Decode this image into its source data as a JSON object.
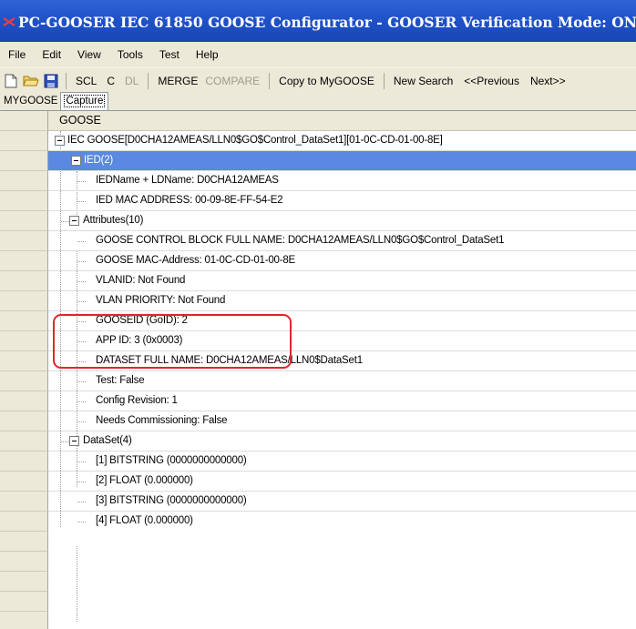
{
  "window": {
    "title": "PC-GOOSER   IEC 61850 GOOSE Configurator - GOOSER Verification Mode: ON"
  },
  "menu": [
    "File",
    "Edit",
    "View",
    "Tools",
    "Test",
    "Help"
  ],
  "toolbar": {
    "scl": "SCL",
    "c": "C",
    "dl": "DL",
    "merge": "MERGE",
    "compare": "COMPARE",
    "copy_to_mygoose": "Copy to MyGOOSE",
    "new_search": "New Search",
    "previous": "<<Previous",
    "next": "Next>>"
  },
  "tabs": [
    "MYGOOSE",
    "Capture"
  ],
  "tree": {
    "header": "GOOSE",
    "root": "IEC GOOSE[D0CHA12AMEAS/LLN0$GO$Control_DataSet1][01-0C-CD-01-00-8E]",
    "ied": {
      "label": "IED(2)",
      "items": [
        "IEDName + LDName: D0CHA12AMEAS",
        "IED MAC ADDRESS: 00-09-8E-FF-54-E2"
      ]
    },
    "attributes": {
      "label": "Attributes(10)",
      "items": [
        "GOOSE CONTROL BLOCK FULL NAME: D0CHA12AMEAS/LLN0$GO$Control_DataSet1",
        "GOOSE MAC-Address: 01-0C-CD-01-00-8E",
        "VLANID: Not Found",
        "VLAN PRIORITY: Not Found",
        "GOOSEID (GoID): 2",
        "APP ID: 3 (0x0003)",
        "DATASET FULL NAME: D0CHA12AMEAS/LLN0$DataSet1",
        "Test: False",
        "Config Revision: 1",
        "Needs Commissioning: False"
      ]
    },
    "dataset": {
      "label": "DataSet(4)",
      "items": [
        "[1] BITSTRING  (0000000000000)",
        "[2] FLOAT  (0.000000)",
        "[3] BITSTRING  (0000000000000)",
        "[4] FLOAT  (0.000000)"
      ]
    }
  },
  "colors": {
    "titlebar": "#1f51c7",
    "selected_row": "#5b88e0",
    "callout": "#e0262b"
  }
}
